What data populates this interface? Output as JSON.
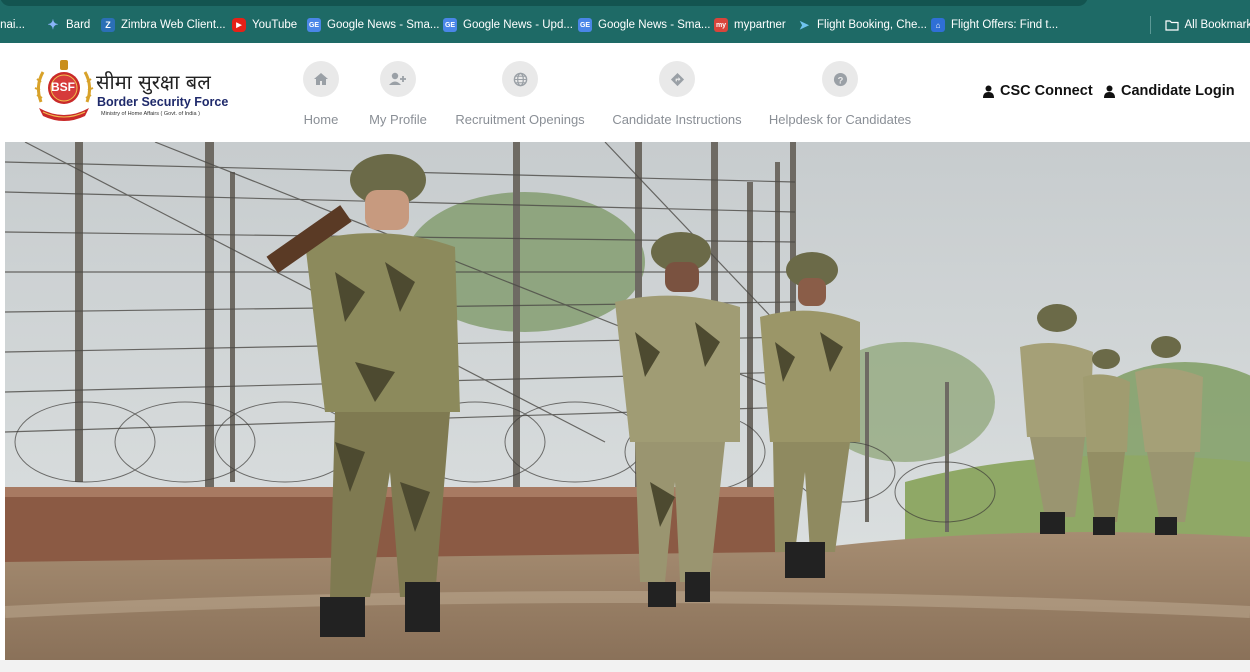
{
  "bookmarks": {
    "items": [
      {
        "label": "Benai...",
        "icon": "bookmark-icon",
        "color": "#1e6a66"
      },
      {
        "label": "Bard",
        "icon": "bard-sparkle-icon",
        "color": "#5b9cf5"
      },
      {
        "label": "Zimbra Web Client...",
        "icon": "zimbra-icon",
        "color": "#2b6fb6"
      },
      {
        "label": "YouTube",
        "icon": "youtube-icon",
        "color": "#e62117"
      },
      {
        "label": "Google News - Sma...",
        "icon": "google-news-icon",
        "color": "#4a86e8"
      },
      {
        "label": "Google News - Upd...",
        "icon": "google-news-icon",
        "color": "#4a86e8"
      },
      {
        "label": "Google News - Sma...",
        "icon": "google-news-icon",
        "color": "#4a86e8"
      },
      {
        "label": "mypartner",
        "icon": "mypartner-icon",
        "color": "#d9443b"
      },
      {
        "label": "Flight Booking, Che...",
        "icon": "flight-icon",
        "color": "#3aa0d6"
      },
      {
        "label": "Flight Offers: Find t...",
        "icon": "flight-offers-icon",
        "color": "#2f6fd6"
      }
    ],
    "all_bookmarks": "All Bookmarks"
  },
  "logo": {
    "badge_text": "BSF",
    "hindi_name": "सीमा सुरक्षा बल",
    "english_name": "Border Security Force",
    "ministry": "Ministry of Home Affairs ( Govt. of India )"
  },
  "nav": [
    {
      "label": "Home",
      "icon": "home-icon"
    },
    {
      "label": "My Profile",
      "icon": "user-plus-icon"
    },
    {
      "label": "Recruitment Openings",
      "icon": "globe-icon"
    },
    {
      "label": "Candidate Instructions",
      "icon": "directions-icon"
    },
    {
      "label": "Helpdesk for Candidates",
      "icon": "question-icon"
    }
  ],
  "header_links": [
    {
      "label": "CSC Connect",
      "icon": "user-icon"
    },
    {
      "label": "Candidate Login",
      "icon": "user-icon"
    }
  ],
  "colors": {
    "bookmark_bar": "#1e6a66",
    "nav_text": "#8a8f96",
    "nav_circle": "#e9e9e9",
    "logo_text": "#1f2a6b"
  }
}
